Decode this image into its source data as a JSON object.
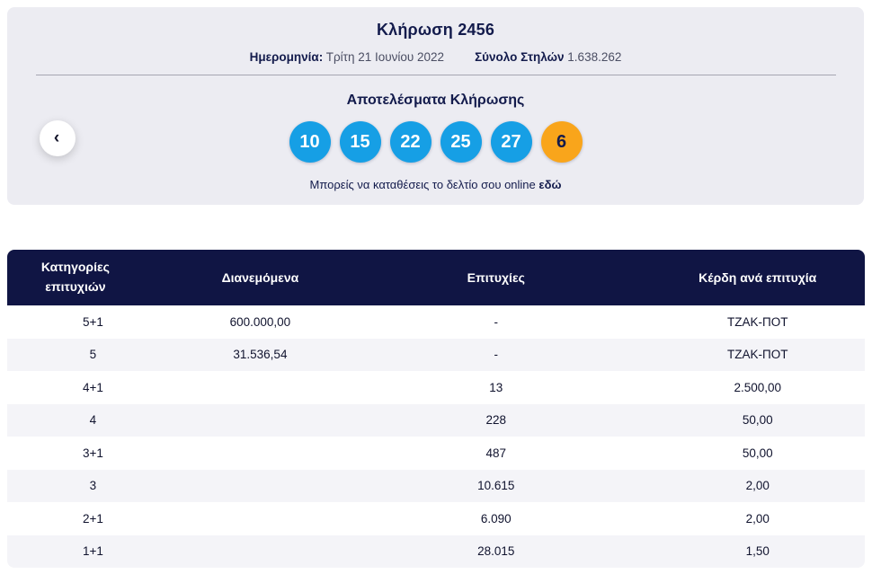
{
  "draw": {
    "title": "Κλήρωση 2456",
    "date_label": "Ημερομηνία:",
    "date_value": "Τρίτη 21 Ιουνίου 2022",
    "columns_label": "Σύνολο Στηλών",
    "columns_value": "1.638.262",
    "results_title": "Αποτελέσματα Κλήρωσης",
    "numbers": [
      "10",
      "15",
      "22",
      "25",
      "27"
    ],
    "bonus": "6",
    "online_text": "Μπορείς να καταθέσεις το δελτίο σου online",
    "online_link": "εδώ",
    "prev_icon": "‹"
  },
  "colors": {
    "ball_blue": "#169fe5",
    "ball_orange": "#f9a51b",
    "header_navy": "#101544",
    "panel_bg": "#ececf2"
  },
  "table": {
    "headers": [
      "Κατηγορίες επιτυχιών",
      "Διανεμόμενα",
      "Επιτυχίες",
      "Κέρδη ανά επιτυχία"
    ],
    "rows": [
      [
        "5+1",
        "600.000,00",
        "-",
        "ΤΖΑΚ-ΠΟΤ"
      ],
      [
        "5",
        "31.536,54",
        "-",
        "ΤΖΑΚ-ΠΟΤ"
      ],
      [
        "4+1",
        "",
        "13",
        "2.500,00"
      ],
      [
        "4",
        "",
        "228",
        "50,00"
      ],
      [
        "3+1",
        "",
        "487",
        "50,00"
      ],
      [
        "3",
        "",
        "10.615",
        "2,00"
      ],
      [
        "2+1",
        "",
        "6.090",
        "2,00"
      ],
      [
        "1+1",
        "",
        "28.015",
        "1,50"
      ]
    ]
  }
}
